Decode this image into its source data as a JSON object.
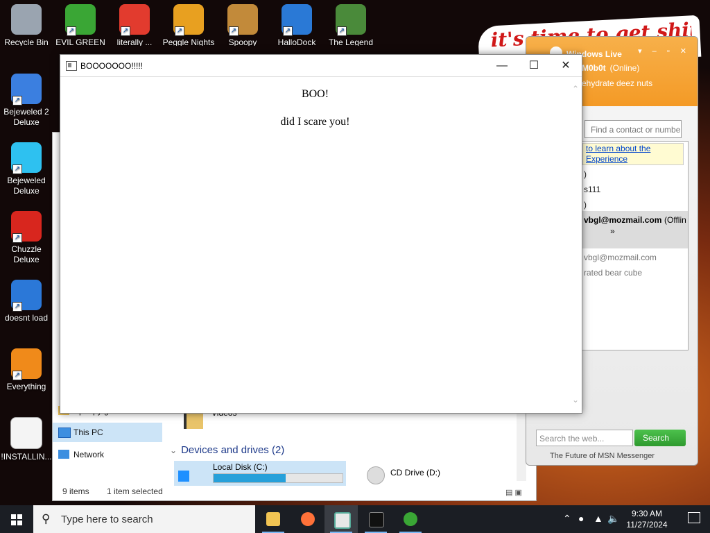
{
  "desktop": {
    "top_icons": [
      {
        "label": "Recycle Bin",
        "icon": "recycle-bin-icon",
        "color": "#9aa4b0"
      },
      {
        "label": "EVIL GREEN MSN CO...",
        "icon": "msn-people-icon",
        "color": "#3aa635"
      },
      {
        "label": "literally ...",
        "icon": "chrome-icon",
        "color": "#e23b2e"
      },
      {
        "label": "Peggle Nights Delu...",
        "icon": "peggle-icon",
        "color": "#e8a020"
      },
      {
        "label": "Spoopy",
        "icon": "spoopy-icon",
        "color": "#c28a3a"
      },
      {
        "label": "HalloDock",
        "icon": "windows-shield-icon",
        "color": "#2a79d6"
      },
      {
        "label": "The Legend of Tild...",
        "icon": "legend-icon",
        "color": "#4a8a3a"
      }
    ],
    "left_icons": [
      {
        "label": "Bejeweled 2 Deluxe",
        "icon": "bejeweled2-icon",
        "color": "#3b7fe0"
      },
      {
        "label": "Bejeweled Deluxe",
        "icon": "diamond-icon",
        "color": "#2ec1f0"
      },
      {
        "label": "Chuzzle Deluxe",
        "icon": "chuzzle-icon",
        "color": "#d8261e"
      },
      {
        "label": "doesnt load",
        "icon": "thunderbird-icon",
        "color": "#2b78d8"
      },
      {
        "label": "Everything",
        "icon": "everything-search-icon",
        "color": "#f08a1a"
      },
      {
        "label": "!INSTALLIN...",
        "icon": "text-file-icon",
        "color": "#f4f4f4"
      }
    ],
    "banner_text": "it's time to get shit"
  },
  "popup": {
    "title": "BOOOOOOO!!!!!",
    "heading": "BOO!",
    "body": "did I scare you!"
  },
  "explorer": {
    "nav_items": [
      {
        "label": "Spoopy games",
        "icon": "folder-icon"
      },
      {
        "label": "This PC",
        "icon": "this-pc-icon",
        "selected": true
      },
      {
        "label": "Network",
        "icon": "network-icon"
      }
    ],
    "videos_label": "Videos",
    "group_title": "Devices and drives (2)",
    "drives": [
      {
        "label": "Local Disk (C:)",
        "used_fraction": 0.56
      },
      {
        "label": "CD Drive (D:)"
      }
    ],
    "status": {
      "items": "9 items",
      "selected": "1 item selected"
    }
  },
  "messenger": {
    "title": "Windows Live",
    "user_name": "M0b0t",
    "user_status": "(Online)",
    "personal_message": "ehydrate deez nuts",
    "search_placeholder": "Find a contact or numbe",
    "info_banner_line1": "to learn about the",
    "info_banner_line2": "Experience",
    "rows": [
      ")",
      "s111",
      ")"
    ],
    "contact_email": "vbgl@mozmail.com",
    "contact_status": "(Offlin",
    "more_glyph": "»",
    "detail_email": "vbgl@mozmail.com",
    "detail_note": "rated bear cube",
    "web_search_placeholder": "Search the web...",
    "web_search_button": "Search",
    "footer": "The Future of MSN Messenger",
    "accent": "#f49a26"
  },
  "taskbar": {
    "search_placeholder": "Type here to search",
    "time": "9:30 AM",
    "date": "11/27/2024"
  }
}
